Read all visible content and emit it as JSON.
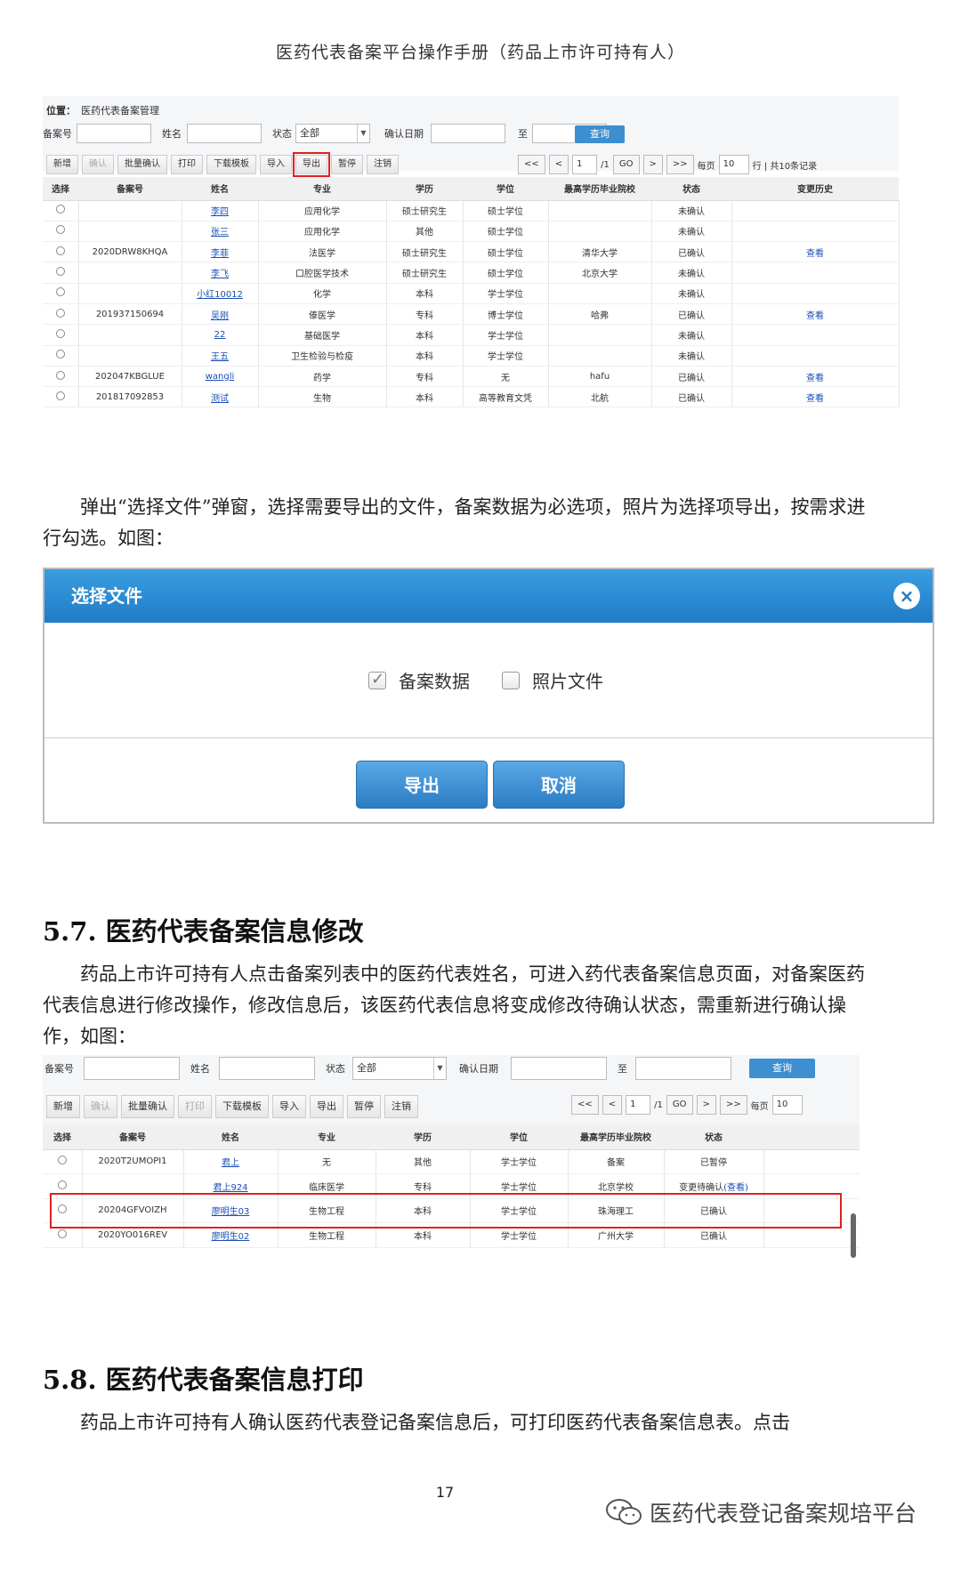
{
  "header": {
    "title": "医药代表备案平台操作手册（药品上市许可持有人）"
  },
  "shot1": {
    "location_label": "位置：",
    "location_value": "医药代表备案管理",
    "filters": {
      "record_no": "备案号",
      "name": "姓名",
      "status": "状态",
      "status_value": "全部",
      "confirm_date": "确认日期",
      "to": "至",
      "query": "查询"
    },
    "toolbar": [
      "新增",
      "确认",
      "批量确认",
      "打印",
      "下载模板",
      "导入",
      "导出",
      "暂停",
      "注销"
    ],
    "pager": {
      "first": "<<",
      "prev": "<",
      "page": "1",
      "total": "/1",
      "go": "GO",
      "next": ">",
      "last": ">>",
      "per_page": "每页",
      "per_value": "10",
      "rows": "行 | 共10条记录"
    },
    "columns": [
      "选择",
      "备案号",
      "姓名",
      "专业",
      "学历",
      "学位",
      "最高学历毕业院校",
      "状态",
      "变更历史"
    ],
    "rows": [
      [
        "",
        "李四",
        "应用化学",
        "硕士研究生",
        "硕士学位",
        "",
        "未确认",
        ""
      ],
      [
        "",
        "张三",
        "应用化学",
        "其他",
        "硕士学位",
        "",
        "未确认",
        ""
      ],
      [
        "2020DRW8KHQA",
        "李菲",
        "法医学",
        "硕士研究生",
        "硕士学位",
        "清华大学",
        "已确认",
        "查看"
      ],
      [
        "",
        "李飞",
        "口腔医学技术",
        "硕士研究生",
        "硕士学位",
        "北京大学",
        "未确认",
        ""
      ],
      [
        "",
        "小红10012",
        "化学",
        "本科",
        "学士学位",
        "",
        "未确认",
        ""
      ],
      [
        "201937150694",
        "吴刚",
        "傣医学",
        "专科",
        "博士学位",
        "哈弗",
        "已确认",
        "查看"
      ],
      [
        "",
        "22",
        "基础医学",
        "本科",
        "学士学位",
        "",
        "未确认",
        ""
      ],
      [
        "",
        "王五",
        "卫生检验与检疫",
        "本科",
        "学士学位",
        "",
        "未确认",
        ""
      ],
      [
        "202047KBGLUE",
        "wangli",
        "药学",
        "专科",
        "无",
        "hafu",
        "已确认",
        "查看"
      ],
      [
        "201817092853",
        "测试",
        "生物",
        "本科",
        "高等教育文凭",
        "北航",
        "已确认",
        "查看"
      ]
    ]
  },
  "para1": "弹出“选择文件”弹窗，选择需要导出的文件，备案数据为必选项，照片为选择项导出，按需求进行勾选。如图：",
  "dialog": {
    "title": "选择文件",
    "close": "×",
    "opt1": "备案数据",
    "opt2": "照片文件",
    "export": "导出",
    "cancel": "取消"
  },
  "section57": {
    "title": "5.7. 医药代表备案信息修改",
    "text": "药品上市许可持有人点击备案列表中的医药代表姓名，可进入药代表备案信息页面，对备案医药代表信息进行修改操作，修改信息后，该医药代表信息将变成修改待确认状态，需重新进行确认操作，如图："
  },
  "shot2": {
    "filters": {
      "record_no": "备案号",
      "name": "姓名",
      "status": "状态",
      "status_value": "全部",
      "confirm_date": "确认日期",
      "to": "至",
      "query": "查询"
    },
    "toolbar": [
      "新增",
      "确认",
      "批量确认",
      "打印",
      "下载模板",
      "导入",
      "导出",
      "暂停",
      "注销"
    ],
    "pager": {
      "first": "<<",
      "prev": "<",
      "page": "1",
      "total": "/1",
      "go": "GO",
      "next": ">",
      "last": ">>",
      "per_page": "每页",
      "per_value": "10"
    },
    "columns": [
      "选择",
      "备案号",
      "姓名",
      "专业",
      "学历",
      "学位",
      "最高学历毕业院校",
      "状态"
    ],
    "rows": [
      [
        "2020T2UMOPI1",
        "君上",
        "无",
        "其他",
        "学士学位",
        "备案",
        "已暂停"
      ],
      [
        "",
        "君上924",
        "临床医学",
        "专科",
        "学士学位",
        "北京学校",
        "变更待确认(查看)"
      ],
      [
        "20204GFVOIZH",
        "廖明生03",
        "生物工程",
        "本科",
        "学士学位",
        "珠海理工",
        "已确认"
      ],
      [
        "2020YO016REV",
        "廖明生02",
        "生物工程",
        "本科",
        "学士学位",
        "广州大学",
        "已确认"
      ]
    ]
  },
  "section58": {
    "title": "5.8. 医药代表备案信息打印",
    "text": "药品上市许可持有人确认医药代表登记备案信息后，可打印医药代表备案信息表。点击"
  },
  "footer": {
    "page_number": "17",
    "watermark": "医药代表登记备案规培平台"
  }
}
